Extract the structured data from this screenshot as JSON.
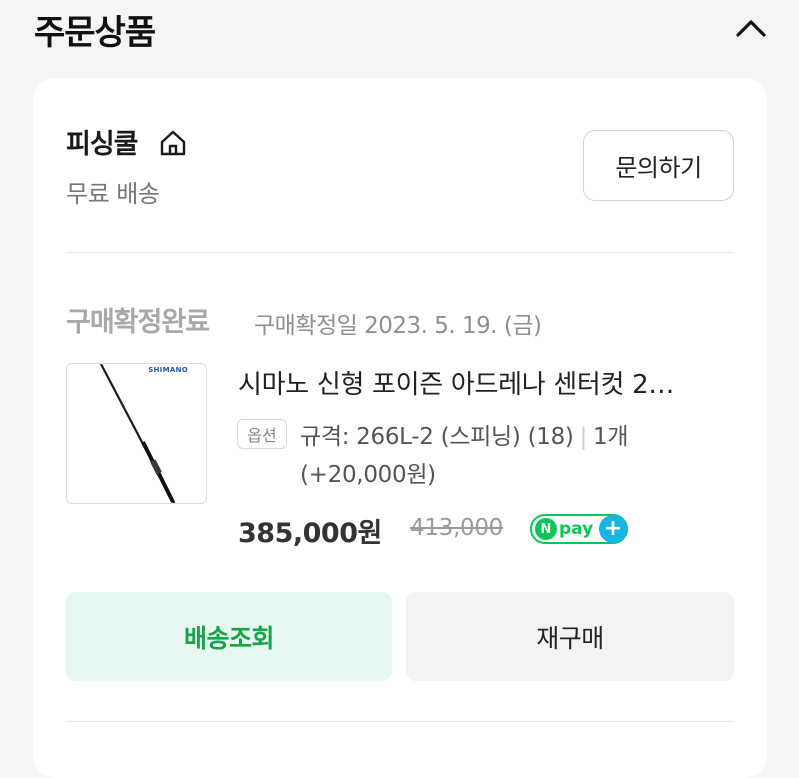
{
  "header": {
    "title": "주문상품"
  },
  "store": {
    "name": "피싱쿨",
    "shipping": "무료 배송",
    "inquiry_label": "문의하기"
  },
  "order": {
    "status": "구매확정완료",
    "status_date": "구매확정일 2023. 5. 19. (금)"
  },
  "product": {
    "thumb_brand": "SHIMANO",
    "name": "시마노 신형 포이즌 아드레나 센터컷 2…",
    "option_badge": "옵션",
    "option_spec": "규격: 266L-2 (스피닝) (18)",
    "option_qty": "1개 (+20,000원)",
    "price": "385,000원",
    "original_price": "413,000",
    "npay_n": "N",
    "npay_label": "pay",
    "npay_plus": "+"
  },
  "actions": {
    "track_label": "배송조회",
    "rebuy_label": "재구매"
  },
  "colors": {
    "accent_green": "#16a34a",
    "track_bg": "#e6f7ef",
    "npay_green": "#06c755",
    "npay_blue": "#17b4e8"
  },
  "icons": {
    "collapse": "chevron-up-icon",
    "store_home": "home-icon"
  }
}
